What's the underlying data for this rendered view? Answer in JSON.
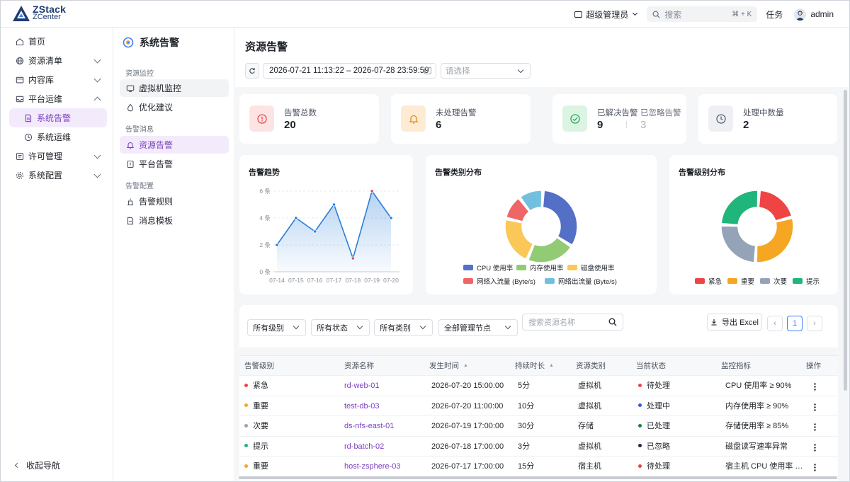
{
  "header": {
    "logo_title": "ZStack",
    "logo_subtitle": "ZCenter",
    "role": "超级管理员",
    "search_placeholder": "搜索",
    "search_shortcut": "⌘ + K",
    "tasks": "任务",
    "user": "admin"
  },
  "sidebar": {
    "items": [
      {
        "label": "首页"
      },
      {
        "label": "资源清单"
      },
      {
        "label": "内容库"
      },
      {
        "label": "平台运维"
      },
      {
        "label": "系统告警"
      },
      {
        "label": "系统运维"
      },
      {
        "label": "许可管理"
      },
      {
        "label": "系统配置"
      }
    ],
    "collapse": "收起导航"
  },
  "subnav": {
    "title": "系统告警",
    "group1": "资源监控",
    "vm_monitor": "虚拟机监控",
    "optimize": "优化建议",
    "group2": "告警消息",
    "resource_alarm": "资源告警",
    "platform_alarm": "平台告警",
    "group3": "告警配置",
    "rules": "告警规则",
    "templates": "消息模板"
  },
  "page": {
    "title": "资源告警",
    "date_range": "2026-07-21 11:13:22 – 2026-07-28 23:59:59",
    "select_placeholder": "请选择"
  },
  "stats": {
    "total_label": "告警总数",
    "total": "20",
    "pending_label": "未处理告警",
    "pending": "6",
    "resolved_label": "已解决告警",
    "resolved": "9",
    "ignored_label": "已忽略告警",
    "ignored": "3",
    "processing_label": "处理中数量",
    "processing": "2"
  },
  "chart_data": [
    {
      "type": "area",
      "title": "告警趋势",
      "categories": [
        "07-14",
        "07-15",
        "07-16",
        "07-17",
        "07-18",
        "07-19",
        "07-20"
      ],
      "values": [
        2,
        4,
        3,
        5,
        1,
        6,
        4
      ],
      "ylim": [
        0,
        6
      ],
      "yticks": [
        "0 条",
        "2 条",
        "4 条",
        "6 条"
      ],
      "grid": true,
      "color": "#2b7fd9"
    },
    {
      "type": "pie",
      "title": "告警类别分布",
      "labels": [
        "CPU 使用率",
        "内存使用率",
        "磁盘使用率",
        "网络入流量 (Byte/s)",
        "网络出流量 (Byte/s)"
      ],
      "values": [
        6,
        4,
        4,
        2,
        2
      ],
      "colors": [
        "#5470c6",
        "#91cc75",
        "#fac858",
        "#ee6666",
        "#73c0de"
      ],
      "legend": "bottom"
    },
    {
      "type": "pie",
      "title": "告警级别分布",
      "labels": [
        "紧急",
        "重要",
        "次要",
        "提示"
      ],
      "values": [
        4,
        6,
        5,
        5
      ],
      "colors": [
        "#ee4444",
        "#f5a623",
        "#94a3b8",
        "#1fb57b"
      ],
      "legend": "bottom"
    }
  ],
  "filters": {
    "level": "所有级别",
    "status": "所有状态",
    "category": "所有类别",
    "nodes": "全部管理节点",
    "search_placeholder": "搜索资源名称",
    "export": "导出 Excel",
    "page": "1"
  },
  "table": {
    "headers": [
      "告警级别",
      "资源名称",
      "发生时间",
      "持续时长",
      "资源类别",
      "当前状态",
      "监控指标",
      "操作"
    ],
    "rows": [
      {
        "level": "紧急",
        "level_color": "#ee4444",
        "name": "rd-web-01",
        "time": "2026-07-20 15:00:00",
        "duration": "5分",
        "type": "虚拟机",
        "status": "待处理",
        "status_color": "#ee4444",
        "metric": "CPU 使用率 ≥ 90%"
      },
      {
        "level": "重要",
        "level_color": "#f5a623",
        "name": "test-db-03",
        "time": "2026-07-20 11:00:00",
        "duration": "10分",
        "type": "虚拟机",
        "status": "处理中",
        "status_color": "#2f5be0",
        "metric": "内存使用率 ≥ 90%"
      },
      {
        "level": "次要",
        "level_color": "#94a3b8",
        "name": "ds-nfs-east-01",
        "time": "2026-07-19 17:00:00",
        "duration": "30分",
        "type": "存储",
        "status": "已处理",
        "status_color": "#1a7f3c",
        "metric": "存储使用率 ≥ 85%"
      },
      {
        "level": "提示",
        "level_color": "#1fb57b",
        "name": "rd-batch-02",
        "time": "2026-07-18 17:00:00",
        "duration": "3分",
        "type": "虚拟机",
        "status": "已忽略",
        "status_color": "#1f2a44",
        "metric": "磁盘读写速率异常"
      },
      {
        "level": "重要",
        "level_color": "#f5a623",
        "name": "host-zsphere-03",
        "time": "2026-07-17 17:00:00",
        "duration": "15分",
        "type": "宿主机",
        "status": "待处理",
        "status_color": "#ee4444",
        "metric": "宿主机 CPU 使用率 ≥ ..."
      }
    ]
  }
}
